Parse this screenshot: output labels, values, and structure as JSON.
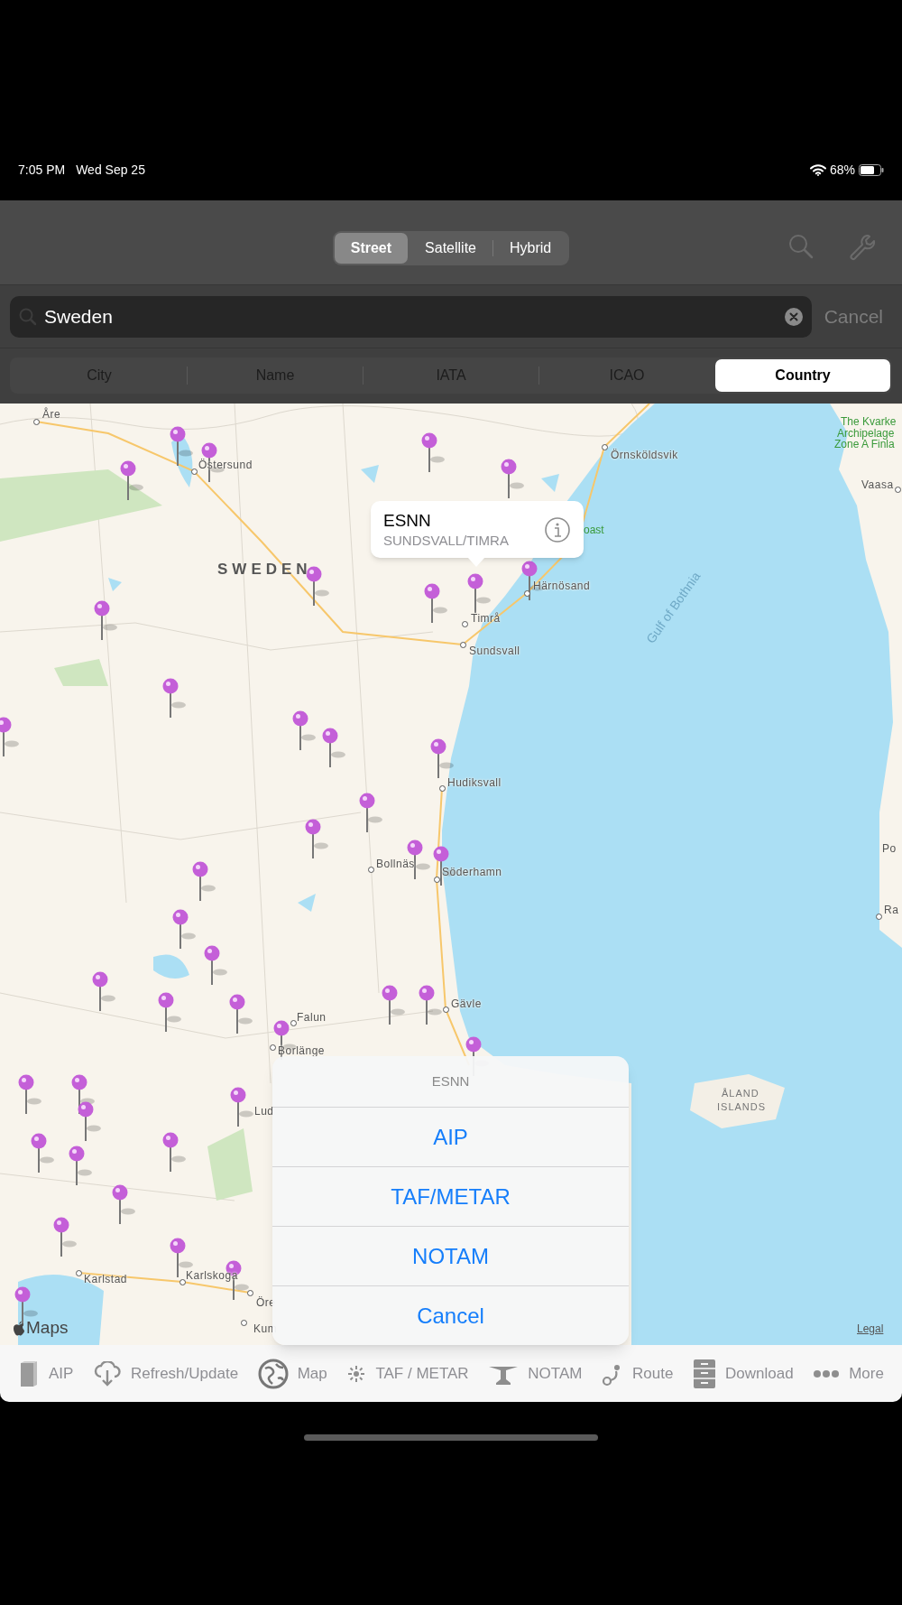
{
  "status_bar": {
    "time": "7:05 PM",
    "date": "Wed Sep 25",
    "battery": "68%"
  },
  "map_types": [
    {
      "label": "Street",
      "selected": true
    },
    {
      "label": "Satellite",
      "selected": false
    },
    {
      "label": "Hybrid",
      "selected": false
    }
  ],
  "search": {
    "value": "Sweden",
    "cancel": "Cancel"
  },
  "scopes": [
    {
      "label": "City",
      "selected": false
    },
    {
      "label": "Name",
      "selected": false
    },
    {
      "label": "IATA",
      "selected": false
    },
    {
      "label": "ICAO",
      "selected": false
    },
    {
      "label": "Country",
      "selected": true
    }
  ],
  "map": {
    "labels": [
      {
        "text": "Åre",
        "kind": "city"
      },
      {
        "text": "Östersund",
        "kind": "city"
      },
      {
        "text": "SWEDEN",
        "kind": "country"
      },
      {
        "text": "Örnsköldsvik",
        "kind": "city"
      },
      {
        "text": "The Kvarke",
        "kind": "park"
      },
      {
        "text": "Archipelage",
        "kind": "park"
      },
      {
        "text": "Zone A Finla",
        "kind": "park"
      },
      {
        "text": "Vaasa",
        "kind": "city"
      },
      {
        "text": "oast",
        "kind": "park"
      },
      {
        "text": "Härnösand",
        "kind": "city"
      },
      {
        "text": "Timrå",
        "kind": "city"
      },
      {
        "text": "Sundsvall",
        "kind": "city"
      },
      {
        "text": "Gulf of Bothnia",
        "kind": "water"
      },
      {
        "text": "Hudiksvall",
        "kind": "city"
      },
      {
        "text": "Bollnäs",
        "kind": "city"
      },
      {
        "text": "Söderhamn",
        "kind": "city"
      },
      {
        "text": "Po",
        "kind": "city"
      },
      {
        "text": "Ra",
        "kind": "city"
      },
      {
        "text": "Gävle",
        "kind": "city"
      },
      {
        "text": "Falun",
        "kind": "city"
      },
      {
        "text": "Borlänge",
        "kind": "city"
      },
      {
        "text": "Lud",
        "kind": "city"
      },
      {
        "text": "ÅLAND",
        "kind": "region"
      },
      {
        "text": "ISLANDS",
        "kind": "region"
      },
      {
        "text": "Karlstad",
        "kind": "city"
      },
      {
        "text": "Karlskoga",
        "kind": "city"
      },
      {
        "text": "Öre",
        "kind": "city"
      },
      {
        "text": "Kum",
        "kind": "city"
      }
    ],
    "callout": {
      "title": "ESNN",
      "subtitle": "SUNDSVALL/TIMRA"
    },
    "attribution": "Maps",
    "legal": "Legal"
  },
  "action_sheet": {
    "title": "ESNN",
    "actions": [
      "AIP",
      "TAF/METAR",
      "NOTAM"
    ],
    "cancel": "Cancel"
  },
  "tab_bar": [
    {
      "label": "AIP",
      "kind": "book"
    },
    {
      "label": "Refresh/Update",
      "kind": "cloud"
    },
    {
      "label": "Map",
      "kind": "globe"
    },
    {
      "label": "TAF / METAR",
      "kind": "weather"
    },
    {
      "label": "NOTAM",
      "kind": "plane"
    },
    {
      "label": "Route",
      "kind": "route"
    },
    {
      "label": "Download",
      "kind": "cabinet"
    },
    {
      "label": "More",
      "kind": "more"
    }
  ]
}
